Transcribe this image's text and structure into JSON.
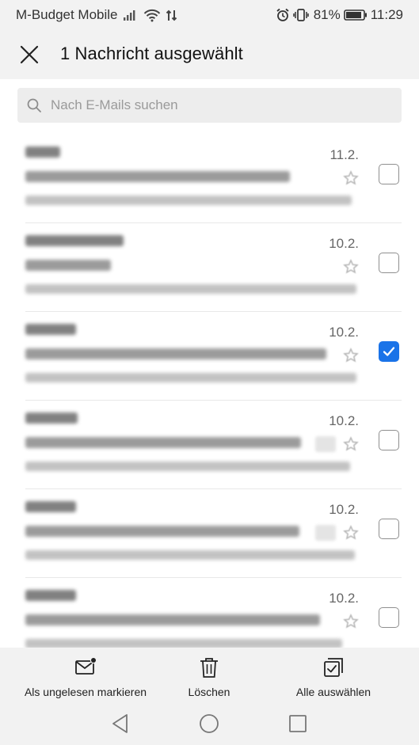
{
  "status_bar": {
    "carrier": "M-Budget Mobile",
    "battery_percent": "81%",
    "time": "11:29",
    "icons": [
      "signal-icon",
      "wifi-icon",
      "data-activity-icon",
      "alarm-icon",
      "vibrate-icon",
      "battery-icon"
    ]
  },
  "header": {
    "close_icon": "close-icon",
    "title": "1 Nachricht ausgewählt"
  },
  "search": {
    "icon": "search-icon",
    "placeholder": "Nach E-Mails suchen",
    "value": ""
  },
  "mail_list": {
    "items": [
      {
        "date": "11.2.",
        "selected": false,
        "has_attachment": false
      },
      {
        "date": "10.2.",
        "selected": false,
        "has_attachment": false
      },
      {
        "date": "10.2.",
        "selected": true,
        "has_attachment": false
      },
      {
        "date": "10.2.",
        "selected": false,
        "has_attachment": true
      },
      {
        "date": "10.2.",
        "selected": false,
        "has_attachment": true
      },
      {
        "date": "10.2.",
        "selected": false,
        "has_attachment": false
      }
    ]
  },
  "actions": {
    "mark_unread": {
      "label": "Als ungelesen markieren",
      "icon": "mail-unread-icon"
    },
    "delete": {
      "label": "Löschen",
      "icon": "trash-icon"
    },
    "select_all": {
      "label": "Alle auswählen",
      "icon": "select-all-icon"
    }
  },
  "nav": {
    "back_icon": "back-triangle-icon",
    "home_icon": "home-circle-icon",
    "recents_icon": "recents-square-icon"
  },
  "colors": {
    "accent": "#1a73e8",
    "background": "#f2f2f2",
    "list_background": "#ffffff"
  }
}
